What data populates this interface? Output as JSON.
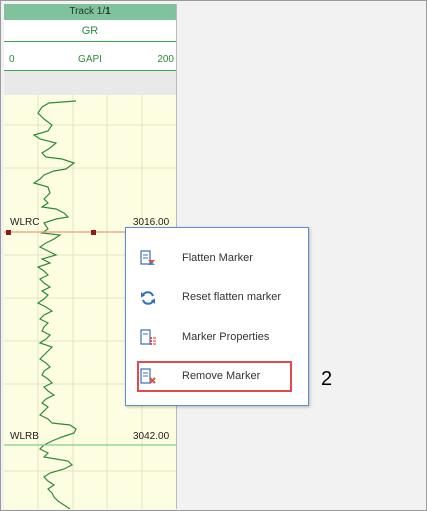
{
  "track": {
    "title_prefix": "Track 1/",
    "title_bold": "1",
    "curve": "GR",
    "scale_min": "0",
    "scale_unit": "GAPI",
    "scale_max": "200"
  },
  "markers": [
    {
      "name": "WLRC",
      "depth": "3016.00"
    },
    {
      "name": "WLRB",
      "depth": "3042.00"
    }
  ],
  "context_menu": {
    "items": [
      {
        "label": "Flatten Marker",
        "icon": "flatten-marker-icon"
      },
      {
        "label": "Reset flatten marker",
        "icon": "refresh-icon"
      },
      {
        "label": "Marker Properties",
        "icon": "marker-properties-icon"
      },
      {
        "label": "Remove Marker",
        "icon": "remove-marker-icon",
        "highlighted": true
      }
    ]
  },
  "step_label": "2",
  "colors": {
    "track_header": "#7fc29b",
    "curve": "#2e8b3a",
    "plot_bg": "#fdfde1",
    "marker_line_c": "#e8a07a",
    "marker_line_b": "#7fd08f",
    "menu_border": "#5b8fd1",
    "highlight": "#e04a4a"
  }
}
